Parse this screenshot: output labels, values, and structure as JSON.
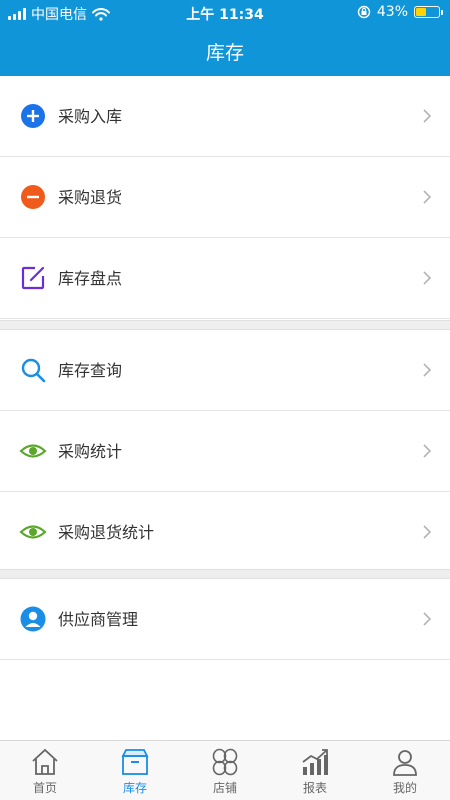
{
  "status_bar": {
    "carrier": "中国电信",
    "time": "上午 11:34",
    "battery": "43%"
  },
  "header": {
    "title": "库存"
  },
  "menu": [
    {
      "label": "采购入库",
      "icon": "plus-circle-icon",
      "color": "#1a73e8"
    },
    {
      "label": "采购退货",
      "icon": "minus-circle-icon",
      "color": "#f05a1a"
    },
    {
      "label": "库存盘点",
      "icon": "edit-icon",
      "color": "#6a2ed8"
    },
    {
      "label": "库存查询",
      "icon": "search-icon",
      "color": "#1a8ee6"
    },
    {
      "label": "采购统计",
      "icon": "eye-icon",
      "color": "#5aa72a"
    },
    {
      "label": "采购退货统计",
      "icon": "eye-icon",
      "color": "#5aa72a"
    },
    {
      "label": "供应商管理",
      "icon": "user-circle-icon",
      "color": "#1a8ee6"
    }
  ],
  "tabbar": {
    "active": "库存",
    "tabs": [
      {
        "label": "首页",
        "icon": "home-icon"
      },
      {
        "label": "库存",
        "icon": "inventory-box-icon"
      },
      {
        "label": "店铺",
        "icon": "store-icon"
      },
      {
        "label": "报表",
        "icon": "chart-icon"
      },
      {
        "label": "我的",
        "icon": "profile-icon"
      }
    ]
  },
  "colors": {
    "header": "#0f95d8",
    "accent": "#1a8ee6"
  }
}
